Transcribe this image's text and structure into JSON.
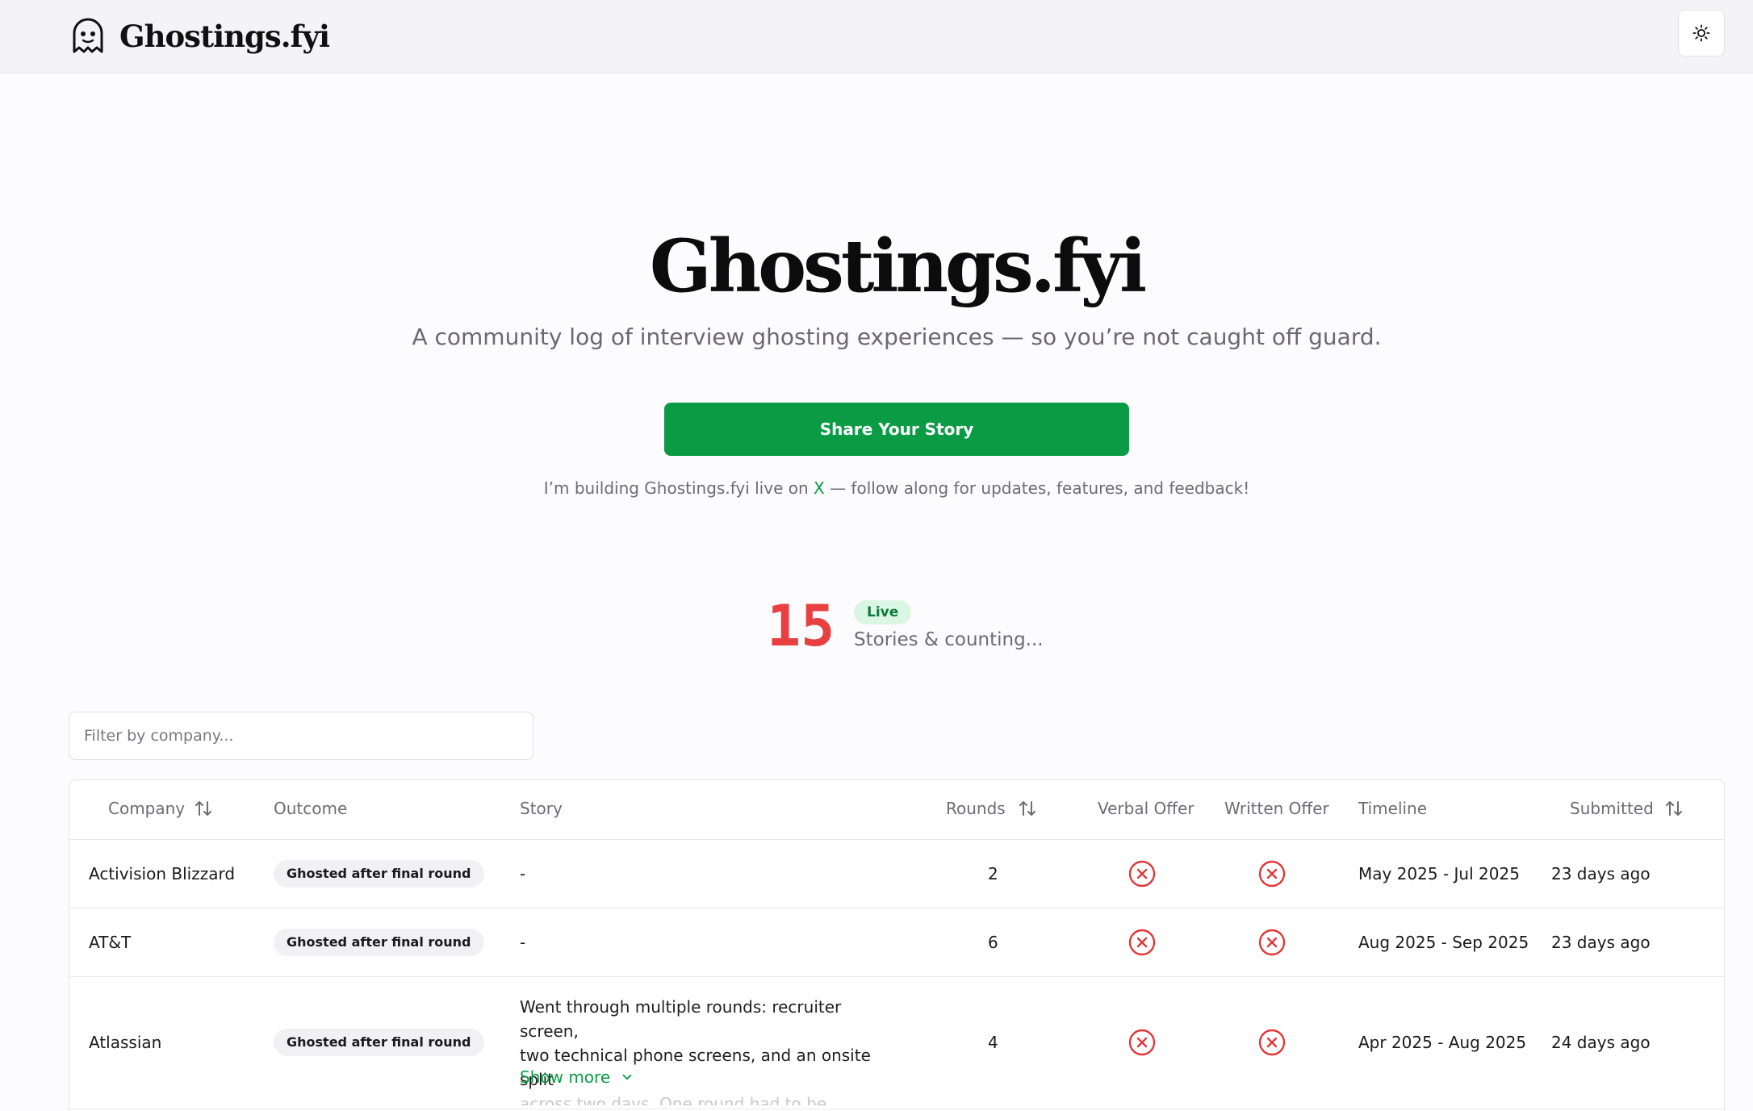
{
  "header": {
    "brand_name": "Ghostings.fyi",
    "brand_icon": "ghost-icon",
    "theme_icon": "sun-icon"
  },
  "hero": {
    "title": "Ghostings.fyi",
    "subtitle": "A community log of interview ghosting experiences — so you’re not caught off guard.",
    "cta_label": "Share Your Story",
    "follow_prefix": "I’m building Ghostings.fyi live on ",
    "follow_link": "X",
    "follow_suffix": " — follow along for updates, features, and feedback!"
  },
  "stats": {
    "count": "15",
    "badge": "Live",
    "label": "Stories & counting..."
  },
  "filter": {
    "placeholder": "Filter by company..."
  },
  "table": {
    "columns": [
      "Company",
      "Outcome",
      "Story",
      "Rounds",
      "Verbal Offer",
      "Written Offer",
      "Timeline",
      "Submitted"
    ],
    "rows": [
      {
        "company": "Activision Blizzard",
        "outcome": "Ghosted after final round",
        "story": "-",
        "rounds": "2",
        "verbal_offer": "x-circle-icon",
        "written_offer": "x-circle-icon",
        "timeline": "May 2025 - Jul 2025",
        "submitted": "23 days ago"
      },
      {
        "company": "AT&T",
        "outcome": "Ghosted after final round",
        "story": "-",
        "rounds": "6",
        "verbal_offer": "x-circle-icon",
        "written_offer": "x-circle-icon",
        "timeline": "Aug 2025 - Sep 2025",
        "submitted": "23 days ago"
      },
      {
        "company": "Atlassian",
        "outcome": "Ghosted after final round",
        "story_line1": "Went through multiple rounds: recruiter screen,",
        "story_line2": "two technical phone screens, and an onsite split",
        "story_line3": "across two days. One round had to be rescheduled",
        "show_more": "Show more",
        "rounds": "4",
        "verbal_offer": "x-circle-icon",
        "written_offer": "x-circle-icon",
        "timeline": "Apr 2025 - Aug 2025",
        "submitted": "24 days ago"
      }
    ]
  },
  "colors": {
    "accent_green": "#0b9b45",
    "count_red": "#e84040",
    "no_offer_red": "#e03838"
  }
}
